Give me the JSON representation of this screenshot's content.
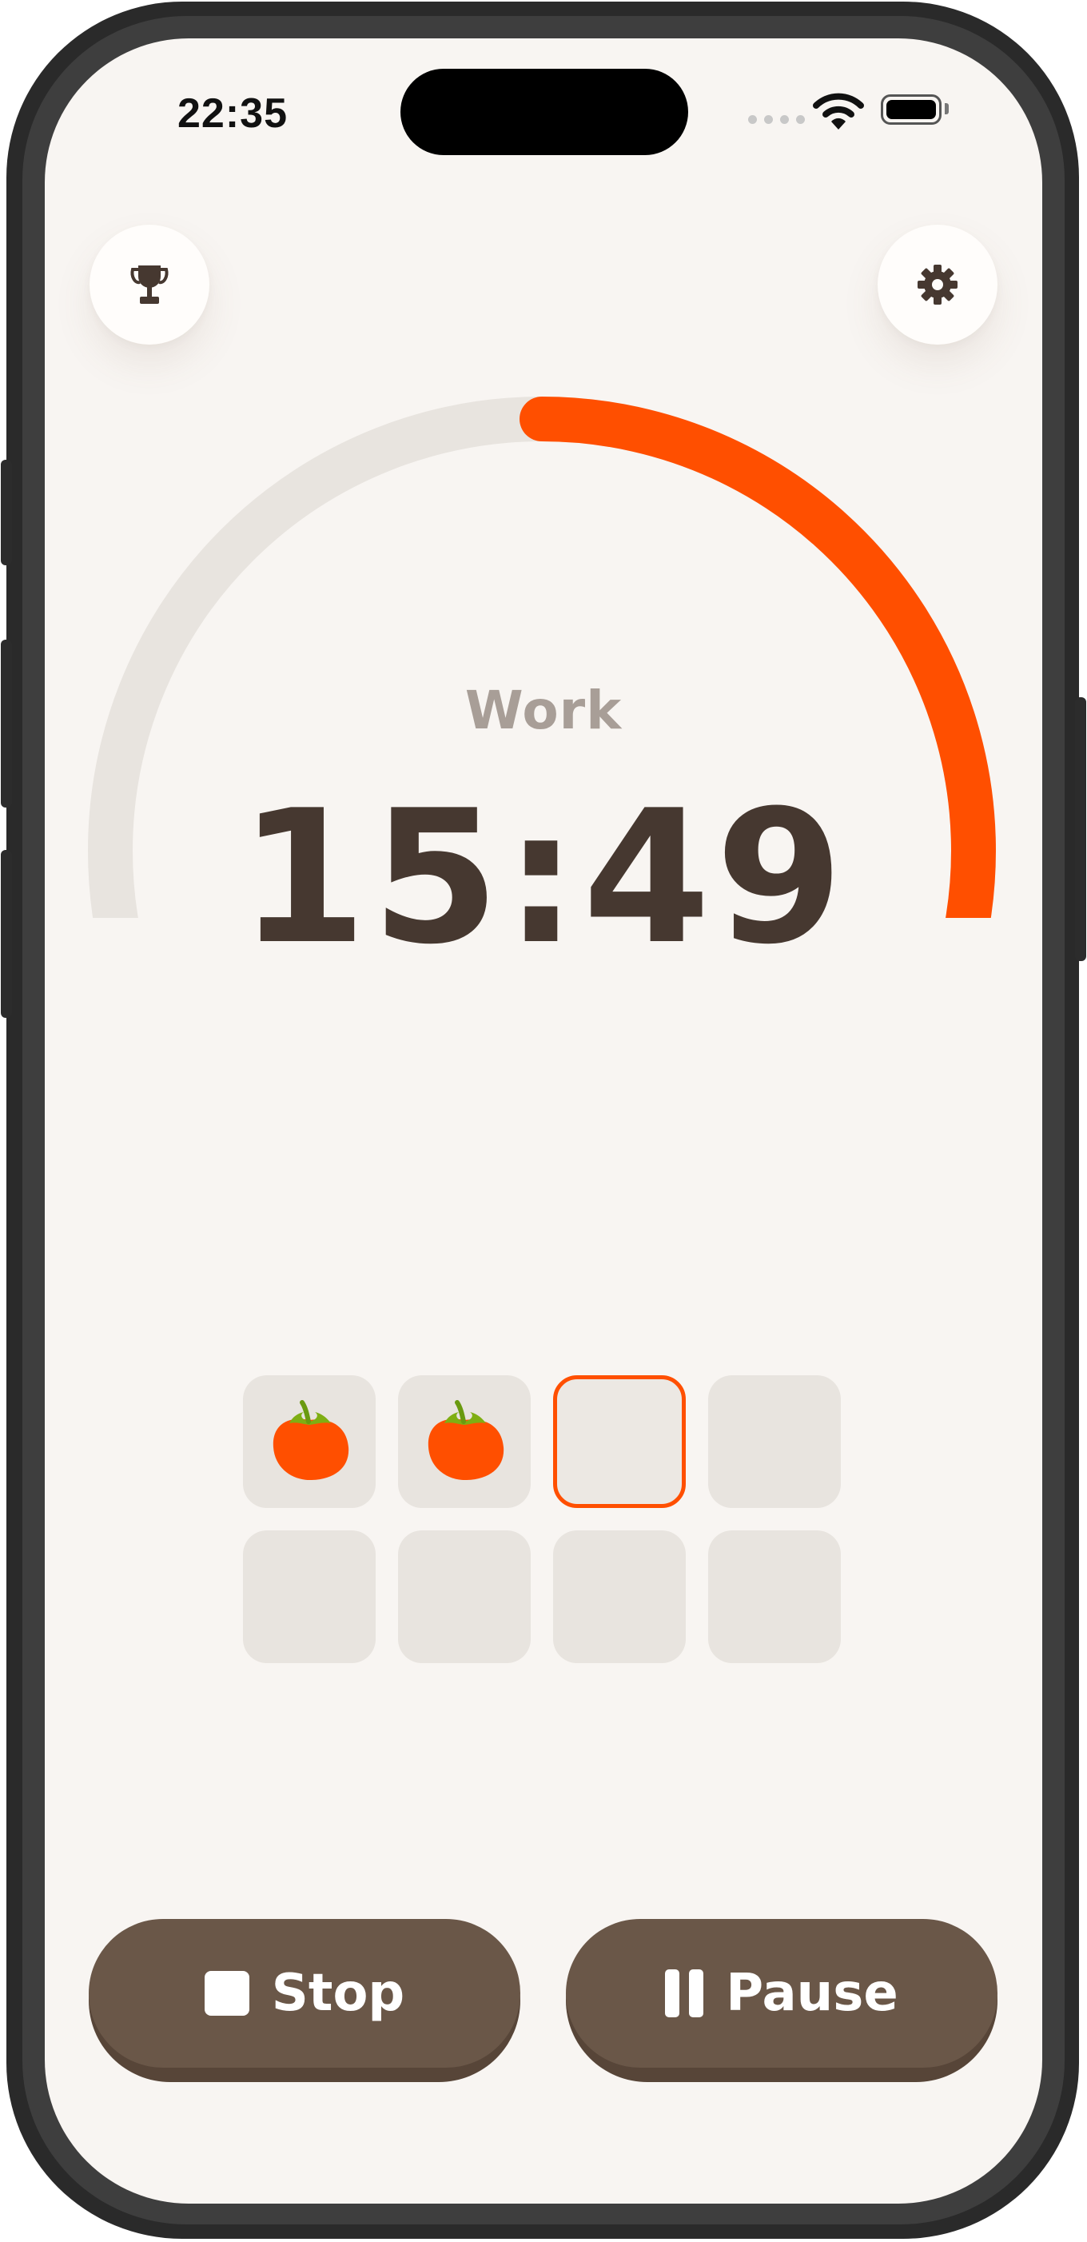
{
  "status_bar": {
    "time": "22:35"
  },
  "timer": {
    "mode": "Work",
    "remaining": "15:49",
    "progress_fraction": 0.64,
    "accent_color": "#ff4f00",
    "track_color": "#e8e4df"
  },
  "header": {
    "left_icon": "trophy-icon",
    "right_icon": "gear-icon"
  },
  "sessions": {
    "total": 8,
    "completed": 2,
    "current_index": 2,
    "completed_icon": "tomato-icon"
  },
  "actions": {
    "stop_label": "Stop",
    "pause_label": "Pause"
  },
  "colors": {
    "background": "#f8f5f2",
    "text_dark": "#463830",
    "button": "#6a5748"
  }
}
